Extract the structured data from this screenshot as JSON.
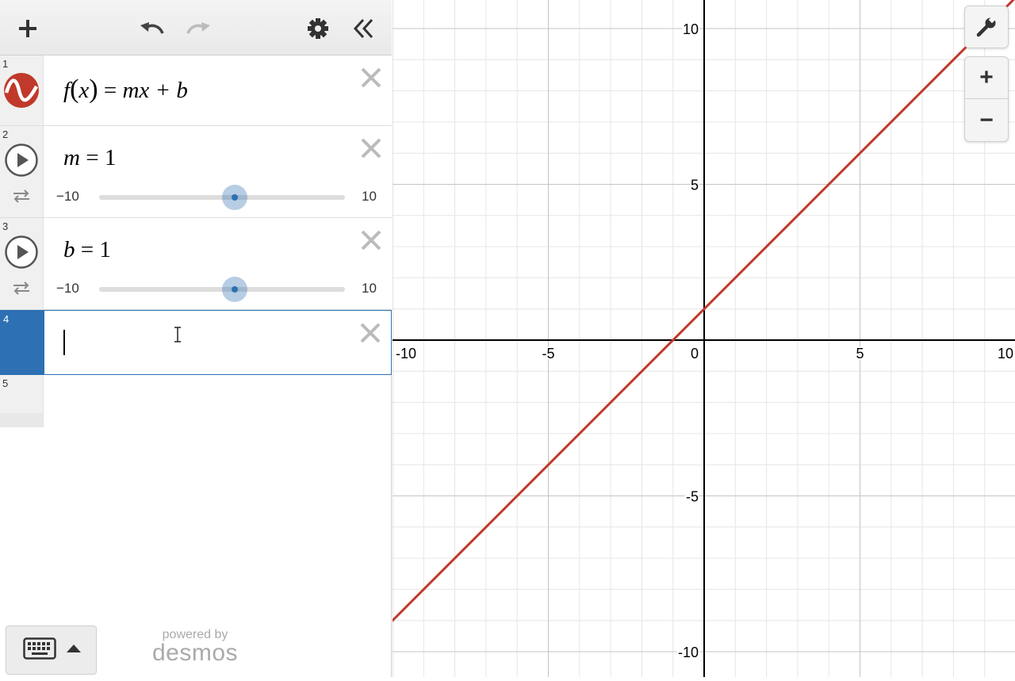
{
  "colors": {
    "accent": "#2d70b3",
    "curve": "#c0392b",
    "grid_minor": "#e6e6e6",
    "grid_major": "#c4c4c4",
    "axis": "#000000"
  },
  "toolbar": {
    "add_icon": "plus-icon",
    "undo_icon": "undo-icon",
    "redo_icon": "redo-icon",
    "settings_icon": "gear-icon",
    "collapse_icon": "double-chevron-left-icon"
  },
  "expressions": [
    {
      "index": "1",
      "lhs": "f",
      "open": "(",
      "arg": "x",
      "close": ")",
      "eq": "=",
      "rhs": "mx + b",
      "color": "#c0392b"
    },
    {
      "index": "2",
      "var": "m",
      "eq": "=",
      "value": "1",
      "min": "−10",
      "max": "10",
      "fraction": 0.55
    },
    {
      "index": "3",
      "var": "b",
      "eq": "=",
      "value": "1",
      "min": "−10",
      "max": "10",
      "fraction": 0.55
    },
    {
      "index": "4",
      "value": ""
    },
    {
      "index": "5"
    }
  ],
  "graph": {
    "x_ticks": [
      "-10",
      "-5",
      "0",
      "5",
      "10"
    ],
    "y_ticks": [
      "10",
      "5",
      "-5",
      "-10"
    ],
    "xlim": [
      -10,
      10
    ],
    "ylim": [
      -10,
      10
    ],
    "line": {
      "slope": 1,
      "intercept": 1
    }
  },
  "controls": {
    "wrench_icon": "wrench-icon",
    "zoom_in_label": "+",
    "zoom_out_label": "−"
  },
  "keyboard": {
    "icon": "keyboard-icon",
    "arrow_icon": "caret-up-icon"
  },
  "branding": {
    "powered_by": "powered by",
    "name": "desmos"
  }
}
